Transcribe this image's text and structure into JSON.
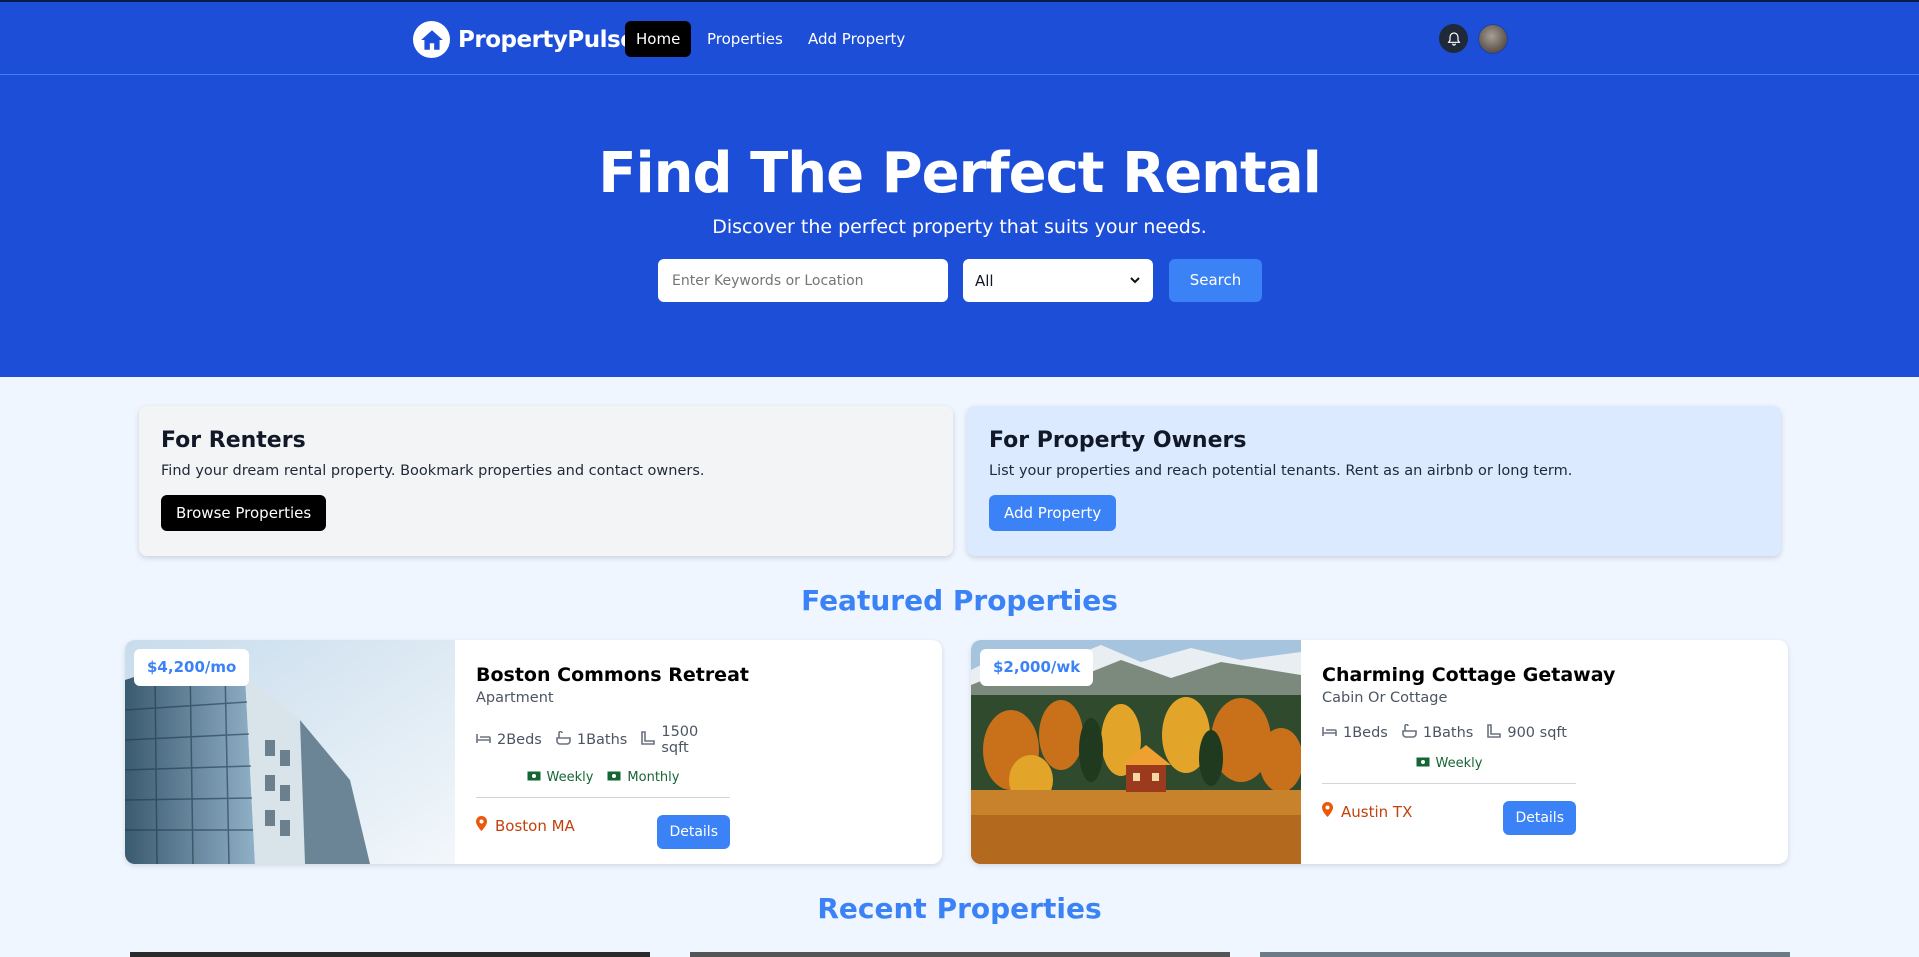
{
  "nav": {
    "brand": "PropertyPulse",
    "links": [
      {
        "label": "Home",
        "active": true
      },
      {
        "label": "Properties",
        "active": false
      },
      {
        "label": "Add Property",
        "active": false
      }
    ],
    "icons": {
      "bell": "bell-icon",
      "avatar": "user-avatar"
    }
  },
  "hero": {
    "title": "Find The Perfect Rental",
    "subtitle": "Discover the perfect property that suits your needs.",
    "search_placeholder": "Enter Keywords or Location",
    "type_selected": "All",
    "search_label": "Search"
  },
  "info": {
    "renters": {
      "title": "For Renters",
      "text": "Find your dream rental property. Bookmark properties and contact owners.",
      "button": "Browse Properties"
    },
    "owners": {
      "title": "For Property Owners",
      "text": "List your properties and reach potential tenants. Rent as an airbnb or long term.",
      "button": "Add Property"
    }
  },
  "featured": {
    "title": "Featured Properties",
    "items": [
      {
        "price": "$4,200/mo",
        "name": "Boston Commons Retreat",
        "type": "Apartment",
        "beds": "2Beds",
        "baths": "1Baths",
        "sqft": "1500 sqft",
        "rates": [
          "Weekly",
          "Monthly"
        ],
        "location": "Boston MA",
        "details": "Details"
      },
      {
        "price": "$2,000/wk",
        "name": "Charming Cottage Getaway",
        "type": "Cabin Or Cottage",
        "beds": "1Beds",
        "baths": "1Baths",
        "sqft": "900 sqft",
        "rates": [
          "Weekly"
        ],
        "location": "Austin TX",
        "details": "Details"
      }
    ]
  },
  "recent": {
    "title": "Recent Properties"
  },
  "colors": {
    "primary": "#1d4ed8",
    "accent": "#3b82f6",
    "location": "#c2410c",
    "rate": "#166534"
  }
}
